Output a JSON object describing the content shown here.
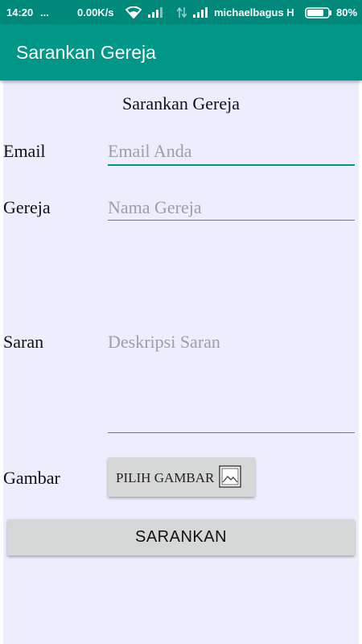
{
  "status_bar": {
    "time": "14:20",
    "dots": "...",
    "speed": "0.00K/s",
    "carrier": "michaelbagus H",
    "battery": "80%"
  },
  "app_bar": {
    "title": "Sarankan Gereja"
  },
  "form": {
    "heading": "Sarankan Gereja",
    "email": {
      "label": "Email",
      "placeholder": "Email Anda"
    },
    "church": {
      "label": "Gereja",
      "placeholder": "Nama Gereja"
    },
    "suggestion": {
      "label": "Saran",
      "placeholder": "Deskripsi Saran"
    },
    "image": {
      "label": "Gambar",
      "button": "PILIH GAMBAR"
    },
    "submit": "SARANKAN"
  },
  "icons": {
    "wifi": "wifi-icon",
    "signal": "signal-icon",
    "battery": "battery-icon",
    "picture": "image-icon"
  },
  "colors": {
    "primary": "#009688",
    "status": "#00897b",
    "background": "#eceefd"
  }
}
